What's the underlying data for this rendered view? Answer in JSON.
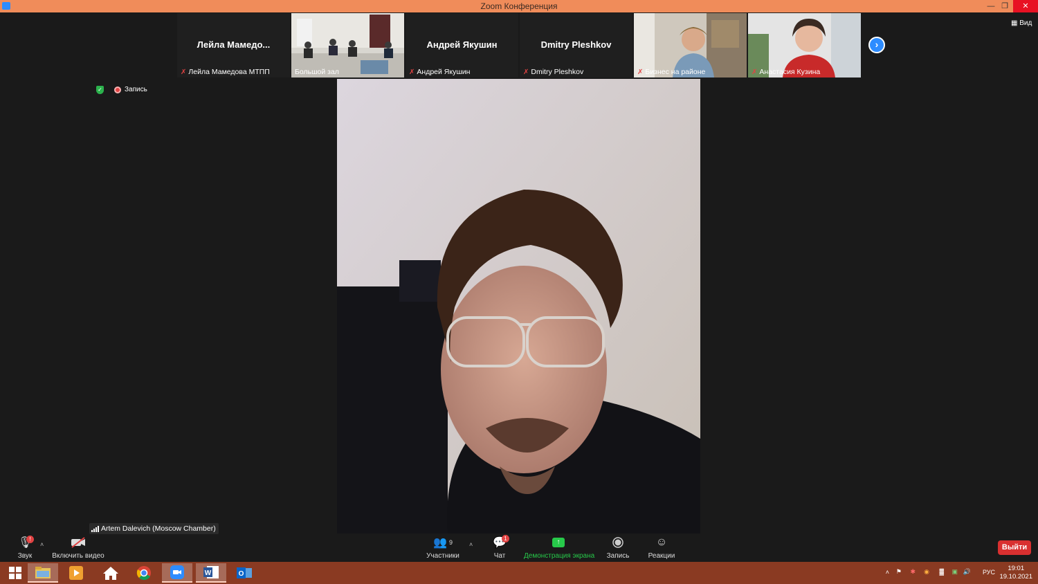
{
  "window": {
    "title": "Zoom Конференция"
  },
  "gallery": {
    "tiles": [
      {
        "big_name": "Лейла  Мамедо...",
        "caption": "Лейла Мамедова МТПП",
        "muted": true
      },
      {
        "big_name": "",
        "caption": "Большой зал",
        "muted": false
      },
      {
        "big_name": "Андрей Якушин",
        "caption": "Андрей Якушин",
        "muted": true
      },
      {
        "big_name": "Dmitry Pleshkov",
        "caption": "Dmitry Pleshkov",
        "muted": true
      },
      {
        "big_name": "",
        "caption": "Бизнес на районе",
        "muted": true
      },
      {
        "big_name": "",
        "caption": "Анастасия Кузина",
        "muted": true
      }
    ],
    "view_label": "Вид"
  },
  "meeting": {
    "recording_label": "Запись"
  },
  "active_speaker": {
    "name": "Artem Dalevich (Moscow Chamber)"
  },
  "toolbar": {
    "audio_label": "Звук",
    "video_label": "Включить видео",
    "participants_label": "Участники",
    "participants_count": "9",
    "chat_label": "Чат",
    "chat_badge": "1",
    "share_label": "Демонстрация экрана",
    "record_label": "Запись",
    "reactions_label": "Реакции",
    "leave_label": "Выйти",
    "audio_badge": "!"
  },
  "taskbar": {
    "apps": [
      "windows-start",
      "file-explorer",
      "media-player",
      "home",
      "chrome",
      "zoom",
      "word",
      "outlook"
    ],
    "language": "РУС",
    "time": "19:01",
    "date": "19.10.2021"
  },
  "colors": {
    "accent": "#2d8cff",
    "titlebar": "#f08c5a",
    "share_green": "#27c94a",
    "leave_red": "#d93030",
    "taskbar": "#8a3a22"
  }
}
